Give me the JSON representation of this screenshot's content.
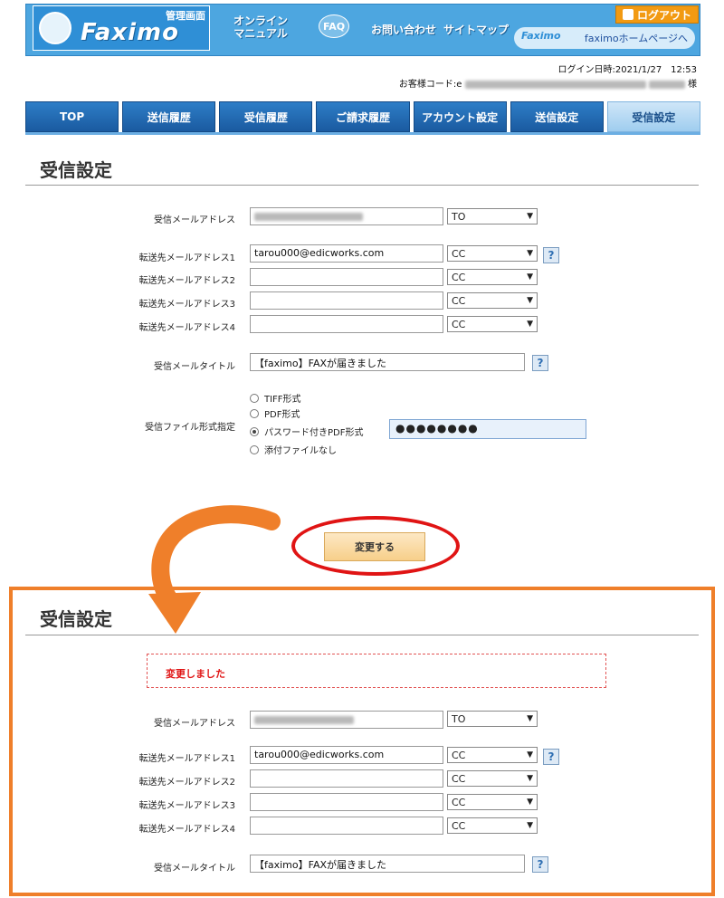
{
  "header": {
    "logo_brand": "Faximo",
    "logo_sub": "管理画面",
    "nav": [
      {
        "label_line1": "オンライン",
        "label_line2": "マニュアル"
      },
      {
        "label": "FAQ"
      },
      {
        "label": "お問い合わせ"
      },
      {
        "label": "サイトマップ"
      }
    ],
    "logout_label": "ログアウト",
    "homepage_label": "faximoホームページへ",
    "homepage_mini": "Faximo"
  },
  "login_info": {
    "login_label": "ログイン日時:",
    "login_value": "2021/1/27　12:53",
    "customer_label": "お客様コード:",
    "customer_prefix": "e",
    "customer_suffix": "様"
  },
  "tabs": [
    {
      "label": "TOP",
      "active": false
    },
    {
      "label": "送信履歴",
      "active": false
    },
    {
      "label": "受信履歴",
      "active": false
    },
    {
      "label": "ご請求履歴",
      "active": false
    },
    {
      "label": "アカウント設定",
      "active": false
    },
    {
      "label": "送信設定",
      "active": false
    },
    {
      "label": "受信設定",
      "active": true
    }
  ],
  "section_title": "受信設定",
  "form": {
    "recv_email_label": "受信メールアドレス",
    "recv_email_type": "TO",
    "forward_labels": [
      "転送先メールアドレス1",
      "転送先メールアドレス2",
      "転送先メールアドレス3",
      "転送先メールアドレス4"
    ],
    "forward_values": [
      "tarou000@edicworks.com",
      "",
      "",
      ""
    ],
    "forward_types": [
      "CC",
      "CC",
      "CC",
      "CC"
    ],
    "mail_title_label": "受信メールタイトル",
    "mail_title_value": "【faximo】FAXが届きました",
    "file_format_label": "受信ファイル形式指定",
    "file_format_options": [
      "TIFF形式",
      "PDF形式",
      "パスワード付きPDF形式",
      "添付ファイルなし"
    ],
    "file_format_selected": 2,
    "password_mask": "●●●●●●●●"
  },
  "submit_label": "変更する",
  "result": {
    "section_title": "受信設定",
    "notice": "変更しました"
  },
  "help_glyph": "?",
  "icons": {
    "help": "help-icon",
    "logout": "door-icon",
    "arrow": "curved-arrow",
    "dropdown": "chevron-down-icon"
  },
  "colors": {
    "tab_blue": "#1a5aa0",
    "highlight_red": "#e01414",
    "highlight_orange": "#ef7f2a",
    "button_peach": "#f7cf8a"
  }
}
